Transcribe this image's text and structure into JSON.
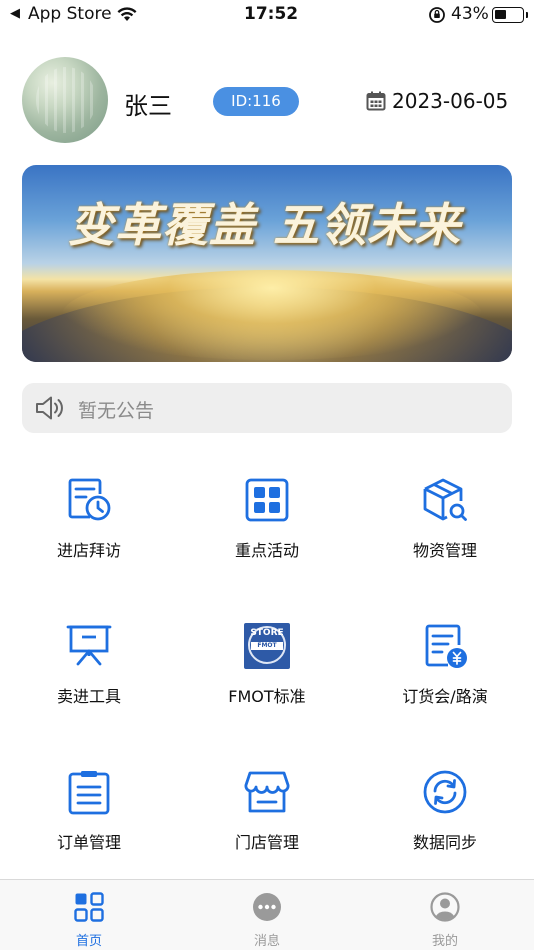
{
  "status_bar": {
    "back_arrow": "◀",
    "back_app": "App Store",
    "time": "17:52",
    "battery_percent": "43%",
    "battery_level": 0.43
  },
  "user": {
    "name": "张三",
    "id_badge": "ID:116",
    "date": "2023-06-05"
  },
  "banner": {
    "text": "变革覆盖 五领未来"
  },
  "notice": {
    "text": "暂无公告"
  },
  "grid": {
    "items": [
      {
        "label": "进店拜访",
        "icon": "store-visit-clock-icon"
      },
      {
        "label": "重点活动",
        "icon": "key-activity-grid-icon"
      },
      {
        "label": "物资管理",
        "icon": "materials-box-search-icon"
      },
      {
        "label": "卖进工具",
        "icon": "presentation-board-icon"
      },
      {
        "label": "FMOT标准",
        "icon": "fmot-store-badge-icon"
      },
      {
        "label": "订货会/路演",
        "icon": "order-document-yen-icon"
      },
      {
        "label": "订单管理",
        "icon": "clipboard-list-icon"
      },
      {
        "label": "门店管理",
        "icon": "storefront-icon"
      },
      {
        "label": "数据同步",
        "icon": "sync-refresh-icon"
      }
    ],
    "fmot_badge_top": "STORE",
    "fmot_badge_mid": "FMOT"
  },
  "tab_bar": {
    "tabs": [
      {
        "label": "首页",
        "icon": "home-grid-icon",
        "active": true
      },
      {
        "label": "消息",
        "icon": "message-bubble-icon",
        "active": false
      },
      {
        "label": "我的",
        "icon": "profile-person-icon",
        "active": false
      }
    ]
  },
  "colors": {
    "accent": "#1e6fe0",
    "id_badge": "#4a90e2",
    "tab_inactive": "#9a9a9a",
    "notice_bg": "#eeeeee"
  }
}
